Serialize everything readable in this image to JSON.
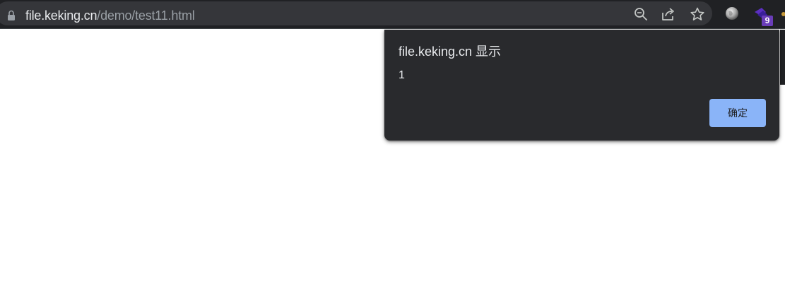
{
  "browser": {
    "url_host": "file.keking.cn",
    "url_path": "/demo/test11.html",
    "icons": {
      "lock": "lock-icon",
      "zoom": "zoom-out-icon",
      "share": "share-icon",
      "bookmark": "star-icon",
      "extension_1": "globe-icon",
      "extension_2": "purple-extension-icon"
    },
    "extension_badge_count": "9"
  },
  "dialog": {
    "title": "file.keking.cn 显示",
    "message": "1",
    "ok_label": "确定"
  },
  "colors": {
    "toolbar_bg": "#202124",
    "omnibox_bg": "#35363a",
    "dialog_bg": "#292a2d",
    "accent_button": "#8ab4f8",
    "text_primary": "#e8eaed",
    "text_secondary": "#9aa0a6",
    "page_bg": "#ffffff"
  }
}
